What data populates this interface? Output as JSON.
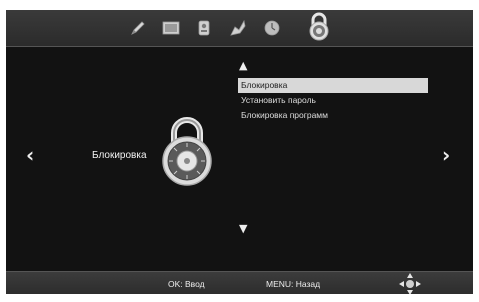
{
  "top_menu": {
    "items": [
      {
        "icon": "pencil-icon"
      },
      {
        "icon": "picture-icon"
      },
      {
        "icon": "channel-list-icon"
      },
      {
        "icon": "settings-icon"
      },
      {
        "icon": "clock-icon"
      },
      {
        "icon": "lock-icon",
        "selected": true
      }
    ]
  },
  "page": {
    "title": "Блокировка",
    "icon": "combination-lock-icon"
  },
  "menu": {
    "items": [
      {
        "label": "Блокировка",
        "selected": true
      },
      {
        "label": "Установить пароль",
        "selected": false
      },
      {
        "label": "Блокировка программ",
        "selected": false
      }
    ]
  },
  "hints": {
    "ok": "OK: Ввод",
    "menu": "MENU: Назад"
  },
  "colors": {
    "selection_bg": "#d8d8d8",
    "background": "#161616",
    "bar": "#333333"
  }
}
